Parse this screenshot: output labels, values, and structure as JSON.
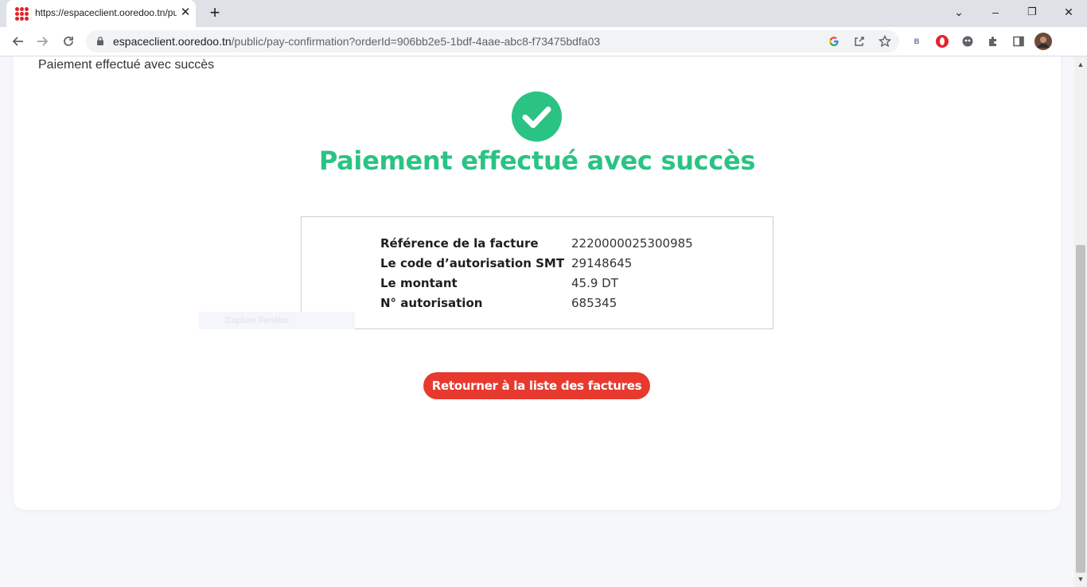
{
  "browser": {
    "tab_title": "https://espaceclient.ooredoo.tn/pu",
    "tab_close": "✕",
    "new_tab": "+",
    "url_domain": "espaceclient.ooredoo.tn",
    "url_path": "/public/pay-confirmation?orderId=906bb2e5-1bdf-4aae-abc8-f73475bdfa03",
    "extension_b_label": "B",
    "window_controls": {
      "tabsearch": "⌄",
      "minimize": "–",
      "restore": "❐",
      "close": "✕"
    },
    "colors": {
      "favicon": "#e4222b"
    }
  },
  "page": {
    "breadcrumb": "Paiement effectué avec succès",
    "success_title": "Paiement effectué avec succès",
    "details": [
      {
        "label": "Référence de la facture",
        "value": "2220000025300985"
      },
      {
        "label": "Le code d’autorisation SMT",
        "value": "29148645"
      },
      {
        "label": "Le montant",
        "value": "45.9 DT"
      },
      {
        "label": "N° autorisation",
        "value": "685345"
      }
    ],
    "faded_caption": "Capture Fenêtre",
    "return_button": "Retourner à la liste des factures",
    "colors": {
      "success": "#2ac383",
      "button": "#e8392f"
    },
    "icons": {
      "success": "check-circle-icon"
    }
  }
}
